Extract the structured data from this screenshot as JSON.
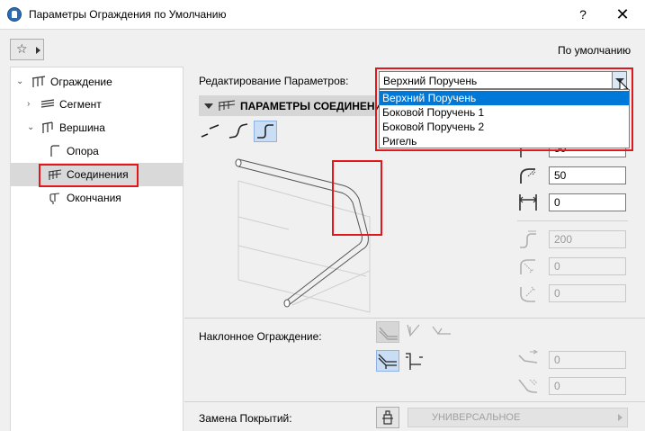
{
  "window": {
    "title": "Параметры Ограждения по Умолчанию",
    "help_label": "?",
    "close_label": "✕"
  },
  "toolbar": {
    "default_label": "По умолчанию"
  },
  "tree": {
    "items": [
      {
        "label": "Ограждение"
      },
      {
        "label": "Сегмент"
      },
      {
        "label": "Вершина"
      },
      {
        "label": "Опора"
      },
      {
        "label": "Соединения"
      },
      {
        "label": "Окончания"
      }
    ],
    "selected": "Соединения"
  },
  "edit_params": {
    "label": "Редактирование Параметров:",
    "value": "Верхний Поручень",
    "options": [
      "Верхний Поручень",
      "Боковой Поручень 1",
      "Боковой Поручень 2",
      "Ригель"
    ]
  },
  "section": {
    "title": "ПАРАМЕТРЫ СОЕДИНЕНИЯ"
  },
  "fields": {
    "top_value": "50",
    "radius_value": "50",
    "offset_value": "0",
    "length_value": "200",
    "angle1_value": "0",
    "angle2_value": "0",
    "incline1_value": "0",
    "incline2_value": "0"
  },
  "incline": {
    "label": "Наклонное Ограждение:"
  },
  "cover": {
    "label": "Замена Покрытий:",
    "value": "УНИВЕРСАЛЬНОЕ"
  },
  "colors": {
    "highlight_red": "#e0181b",
    "selection_blue": "#0078d7"
  }
}
